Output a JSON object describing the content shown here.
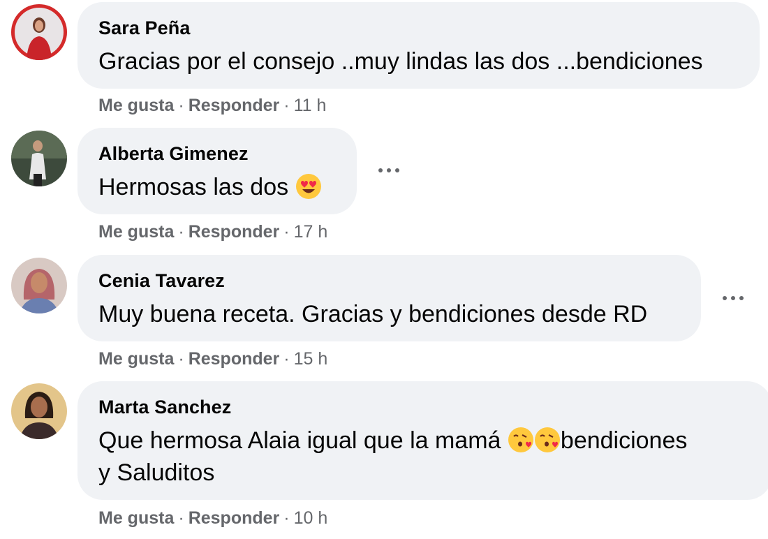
{
  "comments": [
    {
      "author": "Sara Peña",
      "text": "Gracias por el consejo ..muy lindas las dos ...bendiciones",
      "like_label": "Me gusta",
      "reply_label": "Responder",
      "separator": "·",
      "time": "11 h",
      "avatar_icon": "avatar-photo"
    },
    {
      "author": "Alberta Gimenez",
      "text": "Hermosas las dos",
      "emoji": "heart-eyes-emoji",
      "like_label": "Me gusta",
      "reply_label": "Responder",
      "separator": "·",
      "time": "17 h",
      "more_icon": "more-options-icon"
    },
    {
      "author": "Cenia Tavarez",
      "text": "Muy buena receta. Gracias y bendiciones desde RD",
      "like_label": "Me gusta",
      "reply_label": "Responder",
      "separator": "·",
      "time": "15 h",
      "more_icon": "more-options-icon"
    },
    {
      "author": "Marta Sanchez",
      "text_line1_start": "Que hermosa Alaia igual que la mamá",
      "emoji": "kissing-heart-emoji",
      "text_line1_end": "bendiciones",
      "text_line2": "y Saluditos",
      "like_label": "Me gusta",
      "reply_label": "Responder",
      "separator": "·",
      "time": "10 h"
    }
  ],
  "colors": {
    "bubble": "#f0f2f5",
    "text": "#050505",
    "meta": "#65676b",
    "emoji_face": "#ffc83d",
    "heart": "#f02849"
  }
}
